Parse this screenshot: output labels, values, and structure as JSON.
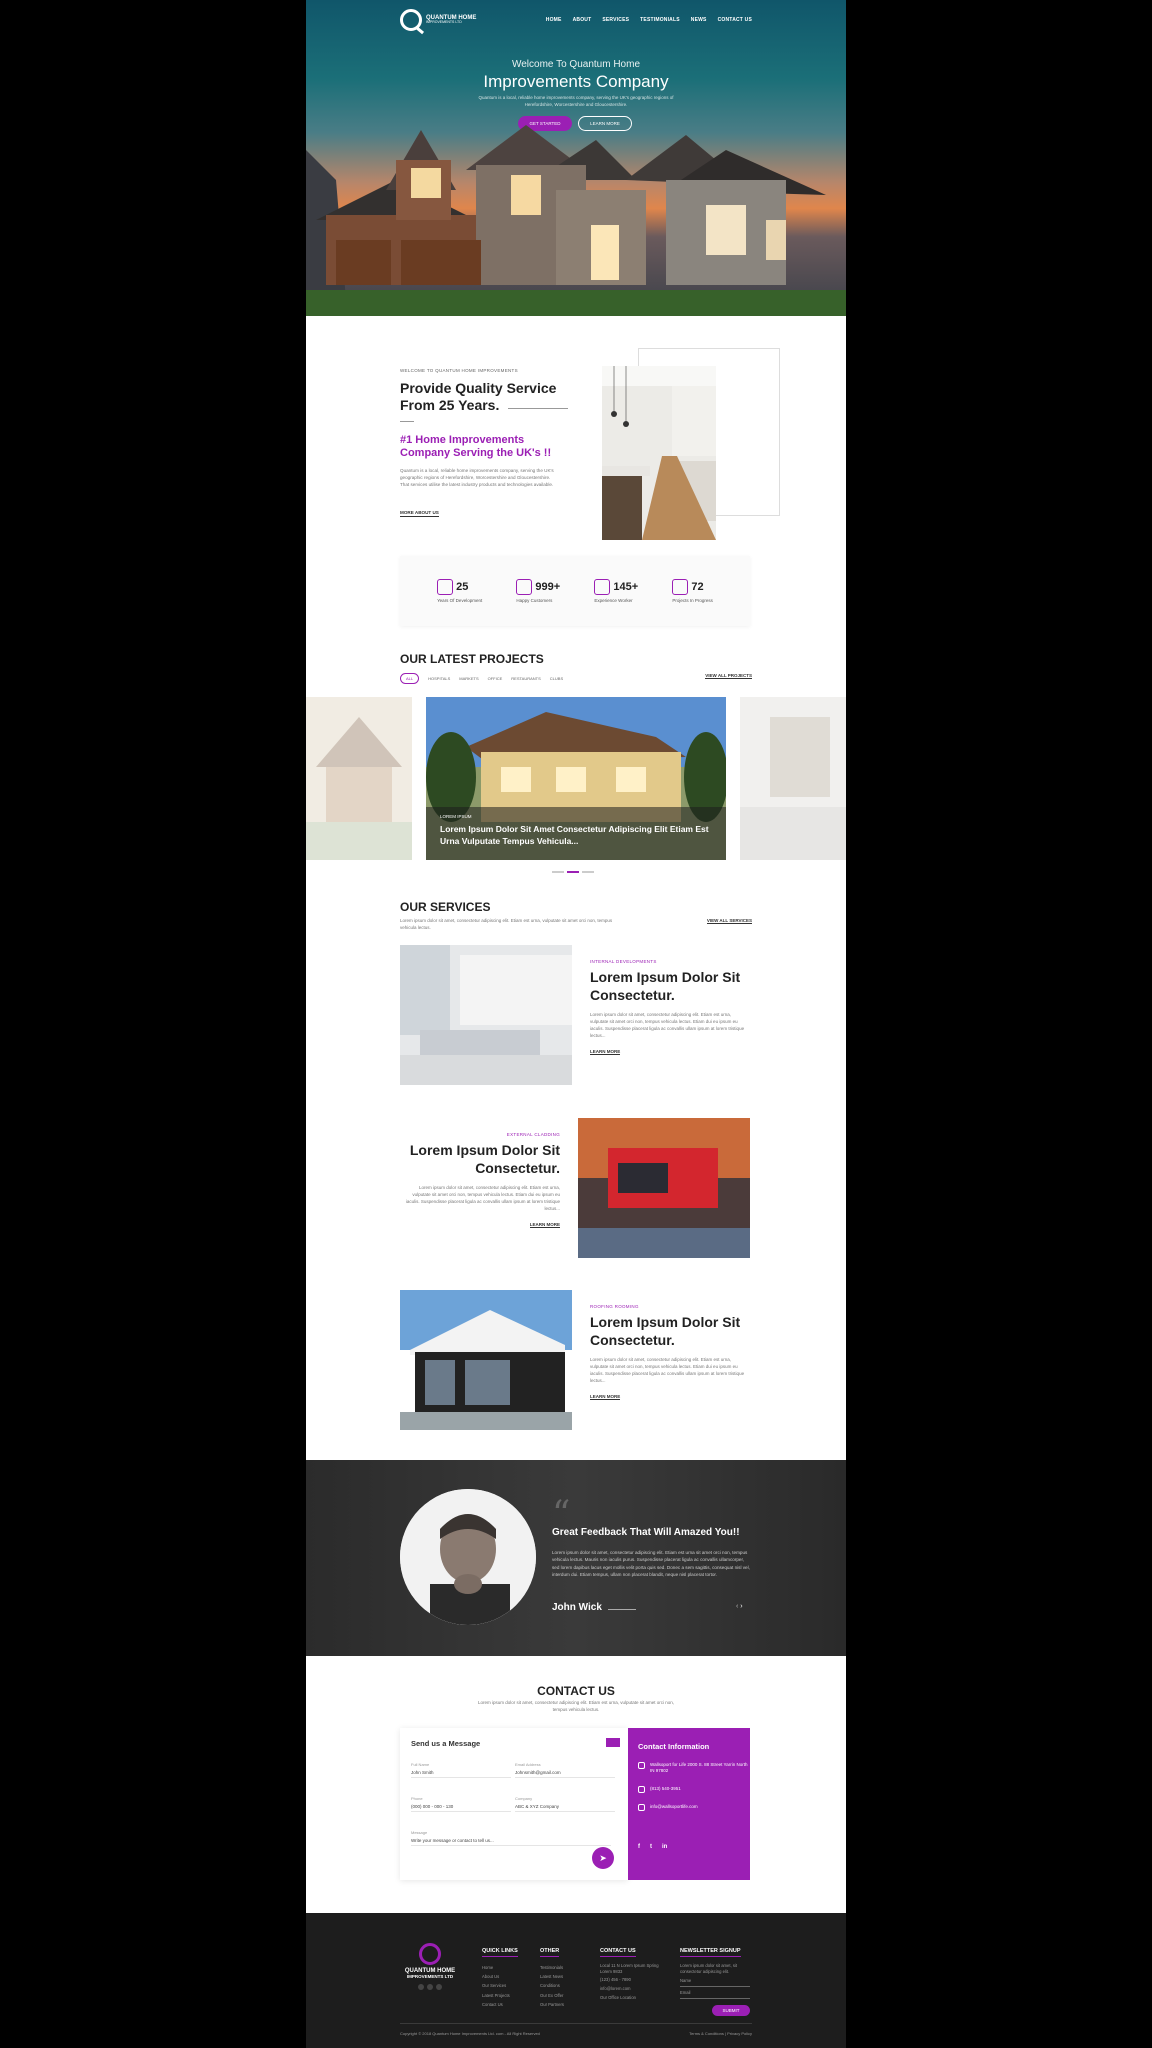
{
  "header": {
    "logo_name": "QUANTUM HOME",
    "logo_sub": "IMPROVEMENTS LTD",
    "nav": [
      "HOME",
      "ABOUT",
      "SERVICES",
      "TESTIMONIALS",
      "NEWS",
      "CONTACT US"
    ]
  },
  "hero": {
    "welcome": "Welcome To Quantum Home",
    "title": "Improvements Company",
    "desc": "Quantum is a local, reliable home improvements company, serving the UK's geographic regions of Herefordshire, Worcestershire and Gloucestershire.",
    "cta_primary": "GET STARTED",
    "cta_secondary": "LEARN MORE"
  },
  "about": {
    "label": "WELCOME TO QUANTUM HOME IMPROVEMENTS",
    "title": "Provide Quality Service From 25 Years.",
    "subtitle": "#1 Home Improvements Company Serving the UK's !!",
    "desc": "Quantum is a local, reliable home improvements company, serving the UK's geographic regions of Herefordshire, Worcestershire and Gloucestershire. That services utilise the latest industry products and technologies available.",
    "read_more": "MORE ABOUT US"
  },
  "stats": [
    {
      "icon": "building-icon",
      "value": "25",
      "label": "Years Of Development"
    },
    {
      "icon": "monitor-icon",
      "value": "999+",
      "label": "Happy Customers"
    },
    {
      "icon": "briefcase-icon",
      "value": "145+",
      "label": "Experience Worker"
    },
    {
      "icon": "clipboard-icon",
      "value": "72",
      "label": "Projects In Progress"
    }
  ],
  "projects": {
    "title": "OUR LATEST PROJECTS",
    "filters": [
      "ALL",
      "HOSPITALS",
      "MARKETS",
      "OFFICE",
      "RESTAURANTS",
      "CLUBS"
    ],
    "view_all": "VIEW ALL PROJECTS",
    "featured_tag": "LOREM IPSUM",
    "featured_text": "Lorem Ipsum Dolor Sit Amet Consectetur Adipiscing Elit Etiam Est Urna Vulputate Tempus Vehicula..."
  },
  "services": {
    "title": "OUR SERVICES",
    "desc": "Lorem ipsum dolor sit amet, consectetur adipiscing elit. Etiam est urna, vulputate sit amet orci non, tempus vehicula lectus.",
    "view_all": "VIEW ALL SERVICES",
    "items": [
      {
        "tag": "INTERNAL DEVELOPMENTS",
        "title": "Lorem Ipsum Dolor Sit Consectetur.",
        "desc": "Lorem ipsum dolor sit amet, consectetur adipiscing elit. Etiam est urna, vulputate sit amet orci non, tempus vehicula lectus. Etiam dui eu ipsum eu iaculis. Suspendisse placerat ligula ac convallis ullam ipsum at lorem tristique lectus...",
        "more": "LEARN MORE"
      },
      {
        "tag": "EXTERNAL CLADDING",
        "title": "Lorem Ipsum Dolor Sit Consectetur.",
        "desc": "Lorem ipsum dolor sit amet, consectetur adipiscing elit. Etiam est urna, vulputate sit amet orci non, tempus vehicula lectus. Etiam dui eu ipsum eu iaculis. Suspendisse placerat ligula ac convallis ullam ipsum at lorem tristique lectus...",
        "more": "LEARN MORE"
      },
      {
        "tag": "ROOFING ROOMING",
        "title": "Lorem Ipsum Dolor Sit Consectetur.",
        "desc": "Lorem ipsum dolor sit amet, consectetur adipiscing elit. Etiam est urna, vulputate sit amet orci non, tempus vehicula lectus. Etiam dui eu ipsum eu iaculis. Suspendisse placerat ligula ac convallis ullam ipsum at lorem tristique lectus...",
        "more": "LEARN MORE"
      }
    ]
  },
  "testimonial": {
    "title": "Great Feedback That Will Amazed You!!",
    "text": "Lorem ipsum dolor sit amet, consectetur adipiscing elit. Etiam est urna sit amet orci non, tempus vehicula lectus. Mauris non iaculis purus. Suspendisse placerat ligula ac convallis ullamcorper, sed lorem dapibus lacus eget mollis velit porta quis sed. Donec a sem sagittis, consequat nisl vel, interdum dui. Etiam tempus, ullam non placerat blandit, neque nisl placerat tortor.",
    "name": "John Wick"
  },
  "contact": {
    "title": "CONTACT US",
    "desc": "Lorem ipsum dolor sit amet, consectetur adipiscing elit. Etiam est urna, vulputate sit amet orci non, tempus vehicula lectus.",
    "form_title": "Send us a Message",
    "fields": [
      {
        "label": "Full Name",
        "value": "John Smith"
      },
      {
        "label": "Email Address",
        "value": "Johnsmith@gmail.com"
      },
      {
        "label": "Phone",
        "value": "(000) 000 - 000 - 130"
      },
      {
        "label": "Company",
        "value": "ABC & XYZ Company"
      }
    ],
    "message_label": "Message",
    "message_value": "Write your message or contact to tell us...",
    "info_title": "Contact Information",
    "info": [
      {
        "icon": "map-pin-icon",
        "text": "Wallsoport for Life 2000 S. 88 Street Yarrin North IN 97802"
      },
      {
        "icon": "phone-icon",
        "text": "(813) 540-3951"
      },
      {
        "icon": "mail-icon",
        "text": "info@wallsoportlife.com"
      }
    ],
    "socials": [
      "f",
      "t",
      "in"
    ]
  },
  "footer": {
    "logo_name": "QUANTUM HOME",
    "logo_sub": "IMPROVEMENTS LTD",
    "cols": [
      {
        "title": "QUICK LINKS",
        "items": [
          "Home",
          "About Us",
          "Our Services",
          "Latest Projects",
          "Contact Us"
        ]
      },
      {
        "title": "OTHER",
        "items": [
          "Testimonials",
          "Latest News",
          "Conditions",
          "Our Ex Offer",
          "Our Partners"
        ]
      },
      {
        "title": "CONTACT US",
        "items": [
          "Local 11 N Lorem Ipsum Spring Lorem 9833",
          "(123) 456 - 7890",
          "info@lorem.com",
          "Our Office Location"
        ]
      }
    ],
    "newsletter_title": "NEWSLETTER SIGNUP",
    "newsletter_desc": "Lorem ipsum dolor sit amet, sit consectetur adipiscing elit.",
    "name_placeholder": "Name",
    "email_placeholder": "Email",
    "subscribe": "SUBMIT",
    "copyright": "Copyright © 2018 Quantum Home Improvements Ltd. com - All Right Reserved",
    "legal": "Terms & Conditions | Privacy Policy"
  },
  "colors": {
    "accent": "#9b1fb4",
    "dark": "#1d1d1d"
  }
}
